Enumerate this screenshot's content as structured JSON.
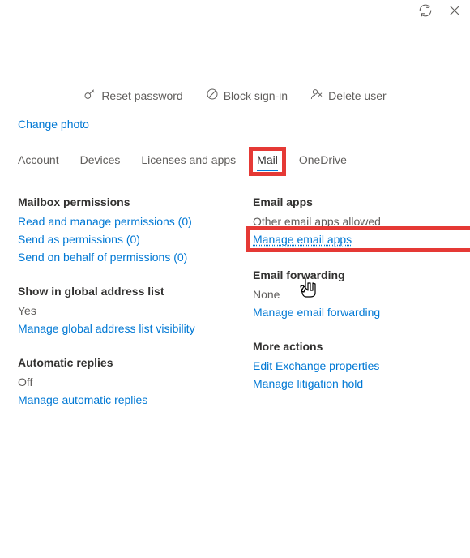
{
  "topbar": {
    "refresh_icon": "refresh",
    "close_icon": "close"
  },
  "actions": {
    "reset_password": "Reset password",
    "block_signin": "Block sign-in",
    "delete_user": "Delete user"
  },
  "change_photo": "Change photo",
  "tabs": {
    "account": "Account",
    "devices": "Devices",
    "licenses": "Licenses and apps",
    "mail": "Mail",
    "onedrive": "OneDrive"
  },
  "left": {
    "mailbox_permissions": {
      "title": "Mailbox permissions",
      "read_manage": "Read and manage permissions (0)",
      "send_as": "Send as permissions (0)",
      "send_on_behalf": "Send on behalf of permissions (0)"
    },
    "global_address": {
      "title": "Show in global address list",
      "value": "Yes",
      "link": "Manage global address list visibility"
    },
    "auto_replies": {
      "title": "Automatic replies",
      "value": "Off",
      "link": "Manage automatic replies"
    }
  },
  "right": {
    "email_apps": {
      "title": "Email apps",
      "value": "Other email apps allowed",
      "link": "Manage email apps"
    },
    "email_forwarding": {
      "title": "Email forwarding",
      "value": "None",
      "link": "Manage email forwarding"
    },
    "more_actions": {
      "title": "More actions",
      "edit_exchange": "Edit Exchange properties",
      "litigation": "Manage litigation hold"
    }
  }
}
